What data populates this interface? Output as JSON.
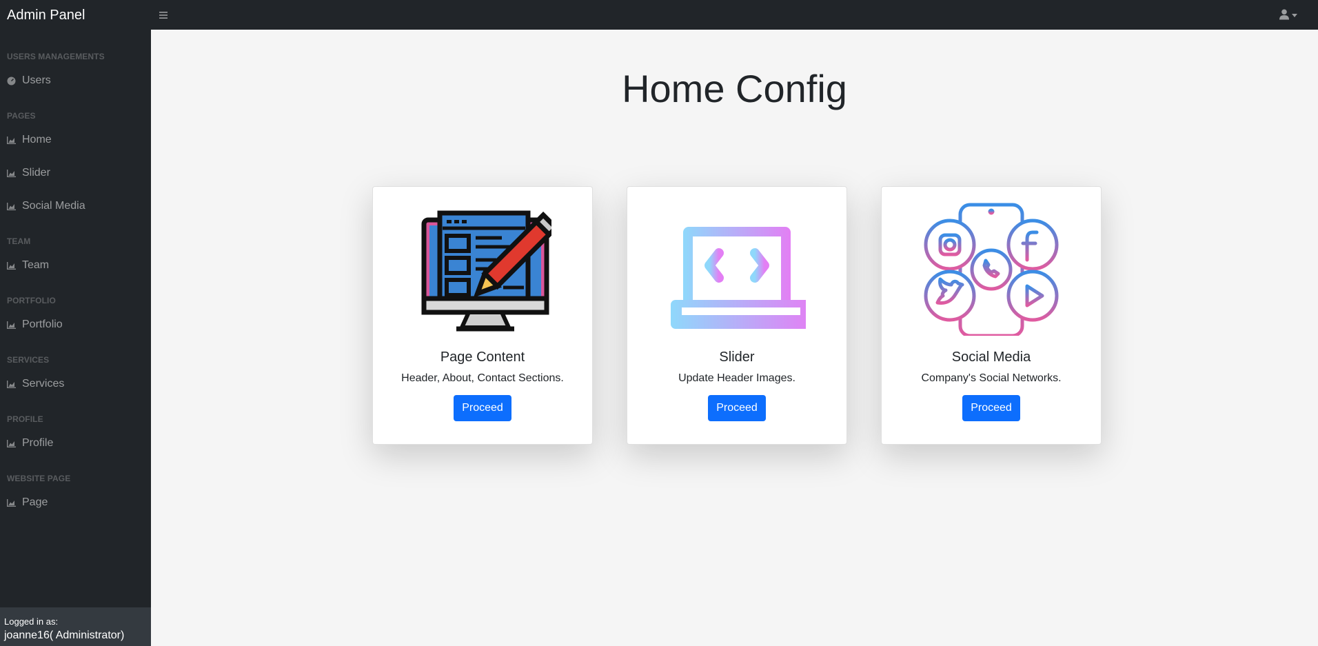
{
  "header": {
    "brand": "Admin Panel",
    "menu_icon": "hamburger-icon",
    "user_icon": "user-icon"
  },
  "sidebar": {
    "sections": [
      {
        "heading": "Users Managements",
        "items": [
          {
            "label": "Users",
            "icon": "gauge-icon"
          }
        ]
      },
      {
        "heading": "Pages",
        "items": [
          {
            "label": "Home",
            "icon": "chart-area-icon"
          },
          {
            "label": "Slider",
            "icon": "chart-area-icon"
          },
          {
            "label": "Social Media",
            "icon": "chart-area-icon"
          }
        ]
      },
      {
        "heading": "Team",
        "items": [
          {
            "label": "Team",
            "icon": "chart-area-icon"
          }
        ]
      },
      {
        "heading": "Portfolio",
        "items": [
          {
            "label": "Portfolio",
            "icon": "chart-area-icon"
          }
        ]
      },
      {
        "heading": "Services",
        "items": [
          {
            "label": "Services",
            "icon": "chart-area-icon"
          }
        ]
      },
      {
        "heading": "Profile",
        "items": [
          {
            "label": "Profile",
            "icon": "chart-area-icon"
          }
        ]
      },
      {
        "heading": "Website Page",
        "items": [
          {
            "label": "Page",
            "icon": "chart-area-icon"
          }
        ]
      }
    ],
    "footer": {
      "label": "Logged in as:",
      "user": "joanne16( Administrator)"
    }
  },
  "main": {
    "title": "Home Config",
    "cards": [
      {
        "title": "Page Content",
        "text": "Header, About, Contact Sections.",
        "button": "Proceed",
        "icon": "monitor-pencil-icon"
      },
      {
        "title": "Slider",
        "text": "Update Header Images.",
        "button": "Proceed",
        "icon": "laptop-slider-icon"
      },
      {
        "title": "Social Media",
        "text": "Company's Social Networks.",
        "button": "Proceed",
        "icon": "phone-social-icon"
      }
    ]
  },
  "colors": {
    "navbar_bg": "#212529",
    "footer_bg": "#343a40",
    "page_bg": "#f5f5f5",
    "primary_button": "#0d6efd"
  }
}
